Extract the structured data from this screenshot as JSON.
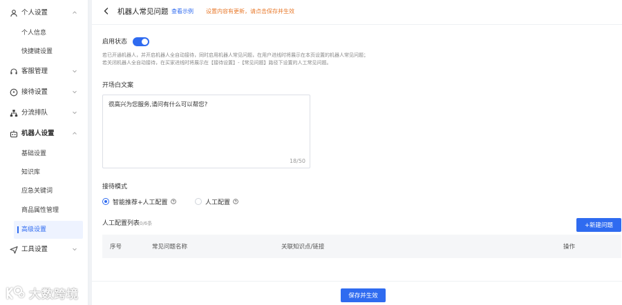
{
  "sidebar": {
    "personal": {
      "label": "个人设置",
      "items": [
        {
          "label": "个人信息"
        },
        {
          "label": "快捷键设置"
        }
      ]
    },
    "cs_mgmt": {
      "label": "客服管理"
    },
    "reception": {
      "label": "接待设置"
    },
    "routing": {
      "label": "分流排队"
    },
    "robot": {
      "label": "机器人设置",
      "items": [
        {
          "label": "基础设置"
        },
        {
          "label": "知识库"
        },
        {
          "label": "应急关键词"
        },
        {
          "label": "商品属性管理"
        },
        {
          "label": "高级设置"
        }
      ]
    },
    "tools": {
      "label": "工具设置"
    }
  },
  "watermark": {
    "text": "大数跨境"
  },
  "header": {
    "title": "机器人常见问题",
    "example_link": "查看示例",
    "notice": "设置内容有更新，请点击保存并生效"
  },
  "status": {
    "label": "启用状态",
    "enabled": true,
    "desc_line1": "若已开通机器人，并开启机器人全自动接待，同时启用机器人常见问题，在用户进线时将展示在本页设置的机器人常见问题；",
    "desc_line2": "若关闭机器人全自动接待，在买家进线时将展示在【接待设置】-【常见问题】路径下设置的人工常见问题。"
  },
  "opening": {
    "label": "开场白文案",
    "value": "很高兴为您服务,请问有什么可以帮您?",
    "counter": "18/50"
  },
  "mode": {
    "label": "接待模式",
    "options": [
      {
        "label": "智能推荐+人工配置",
        "checked": true
      },
      {
        "label": "人工配置",
        "checked": false
      }
    ]
  },
  "manual_list": {
    "title": "人工配置列表",
    "count": "0/6条",
    "add_button": "+新建问题",
    "columns": [
      "序号",
      "常见问题名称",
      "关联知识点/链接",
      "操作"
    ]
  },
  "footer": {
    "save_button": "保存并生效"
  },
  "colors": {
    "accent": "#2f6bf0",
    "notice": "#e87a2c"
  }
}
